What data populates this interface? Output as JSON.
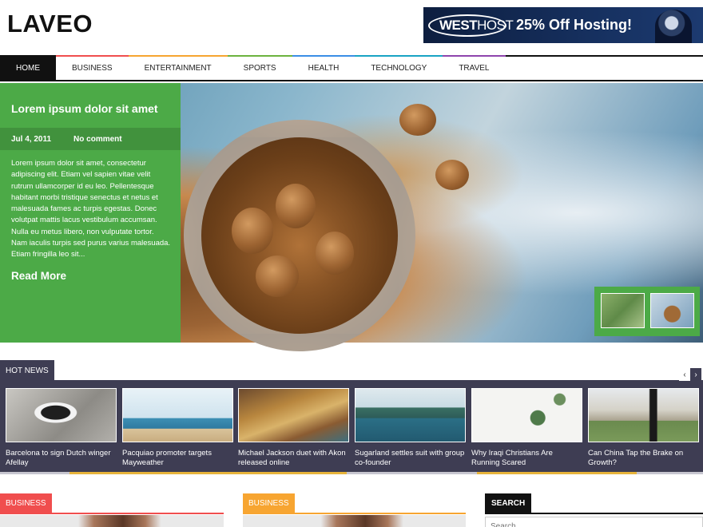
{
  "site": {
    "logo": "LAVEO"
  },
  "ad": {
    "brand_bold": "WEST",
    "brand_rest": "HOST",
    "offer": "25% Off Hosting!"
  },
  "nav": {
    "items": [
      {
        "label": "HOME",
        "color": "#111111"
      },
      {
        "label": "BUSINESS",
        "color": "#f04e4e"
      },
      {
        "label": "ENTERTAINMENT",
        "color": "#f7a531"
      },
      {
        "label": "SPORTS",
        "color": "#6cb33f"
      },
      {
        "label": "HEALTH",
        "color": "#3a8ee6"
      },
      {
        "label": "TECHNOLOGY",
        "color": "#19a3c4"
      },
      {
        "label": "TRAVEL",
        "color": "#8e44ad"
      }
    ]
  },
  "featured": {
    "title": "Lorem ipsum dolor sit amet",
    "date": "Jul 4, 2011",
    "comments": "No comment",
    "excerpt": "Lorem ipsum dolor sit amet, consectetur adipiscing elit. Etiam vel sapien vitae velit rutrum ullamcorper id eu leo. Pellentesque habitant morbi tristique senectus et netus et malesuada fames ac turpis egestas. Donec volutpat mattis lacus vestibulum accumsan. Nulla eu metus libero, non vulputate tortor. Nam iaculis turpis sed purus varius malesuada. Etiam fringilla leo sit...",
    "read_more": "Read More",
    "panel_color": "#4caa47"
  },
  "hot_news": {
    "label": "HOT NEWS",
    "prev": "‹",
    "next": "›",
    "items": [
      {
        "caption": "Barcelona to sign Dutch winger Afellay"
      },
      {
        "caption": "Pacquiao promoter targets Mayweather"
      },
      {
        "caption": "Michael Jackson duet with Akon released online"
      },
      {
        "caption": "Sugarland settles suit with group co-founder"
      },
      {
        "caption": "Why Iraqi Christians Are Running Scared"
      },
      {
        "caption": "Can China Tap the Brake on Growth?"
      }
    ]
  },
  "sections": [
    {
      "label": "BUSINESS",
      "color": "#f04e4e"
    },
    {
      "label": "BUSINESS",
      "color": "#f7a531"
    }
  ],
  "sidebar": {
    "search_label": "SEARCH",
    "search_placeholder": "Search ..."
  }
}
